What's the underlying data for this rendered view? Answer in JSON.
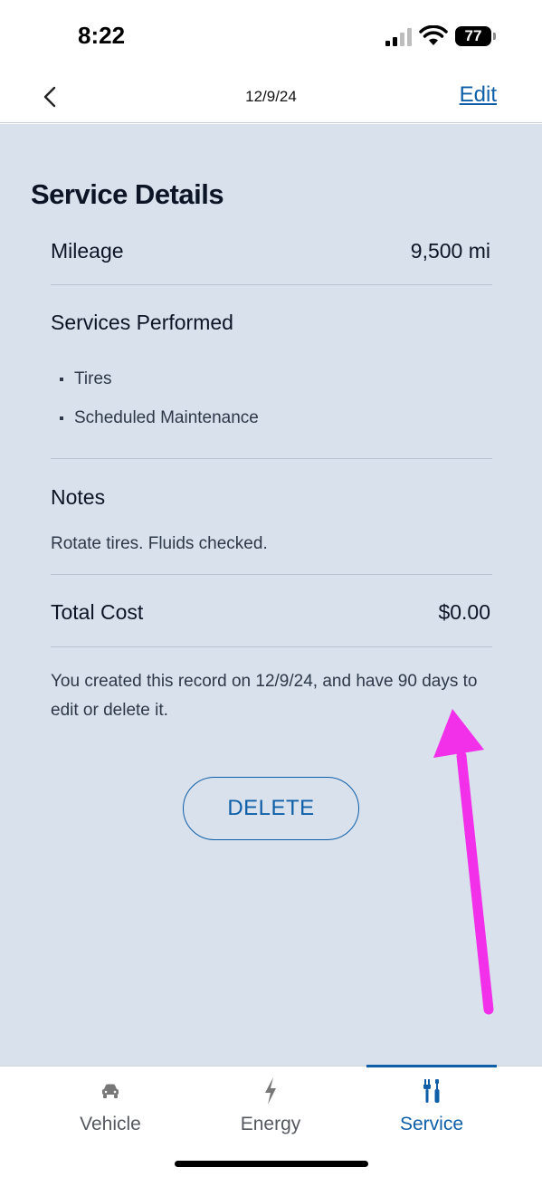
{
  "status_bar": {
    "time": "8:22",
    "battery": "77",
    "icons": [
      "signal-icon",
      "wifi-icon",
      "battery-icon"
    ]
  },
  "header": {
    "title": "12/9/24",
    "edit_label": "Edit",
    "back_icon": "chevron-left-icon"
  },
  "details": {
    "section_title": "Service Details",
    "mileage_label": "Mileage",
    "mileage_value": "9,500 mi",
    "services_label": "Services Performed",
    "services": [
      "Tires",
      "Scheduled Maintenance"
    ],
    "notes_label": "Notes",
    "notes_text": "Rotate tires.  Fluids checked.",
    "total_cost_label": "Total Cost",
    "total_cost_value": "$0.00",
    "info_text": "You created this record on 12/9/24, and have 90 days to edit or delete it.",
    "delete_label": "DELETE"
  },
  "tabs": [
    {
      "label": "Vehicle",
      "icon": "car-icon",
      "active": false
    },
    {
      "label": "Energy",
      "icon": "lightning-icon",
      "active": false
    },
    {
      "label": "Service",
      "icon": "wrench-screwdriver-icon",
      "active": true
    }
  ],
  "colors": {
    "accent": "#0e5fa8",
    "content_background": "#d9e1ec",
    "annotation_arrow": "#f22fe9"
  }
}
